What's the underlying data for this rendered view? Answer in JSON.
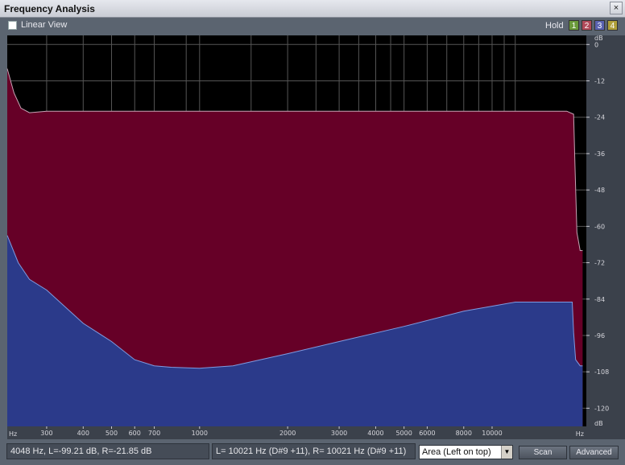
{
  "window": {
    "title": "Frequency Analysis",
    "close_glyph": "×"
  },
  "toolbar": {
    "linear_view_label": "Linear View",
    "linear_view_checked": false,
    "hold_label": "Hold",
    "hold_buttons": [
      {
        "label": "1",
        "color": "#6a9a3a"
      },
      {
        "label": "2",
        "color": "#b04a5a"
      },
      {
        "label": "3",
        "color": "#5a62b0"
      },
      {
        "label": "4",
        "color": "#b0a03a"
      }
    ]
  },
  "chart_data": {
    "type": "area",
    "xscale": "log",
    "xlim": [
      220,
      21000
    ],
    "ylim": [
      -126,
      3
    ],
    "x_unit_left": "Hz",
    "x_unit_right": "Hz",
    "y_unit_top": "dB",
    "y_unit_bottom": "dB",
    "xticks": [
      {
        "value": 300,
        "label": "300"
      },
      {
        "value": 400,
        "label": "400"
      },
      {
        "value": 500,
        "label": "500"
      },
      {
        "value": 600,
        "label": "600"
      },
      {
        "value": 700,
        "label": "700"
      },
      {
        "value": 1000,
        "label": "1000"
      },
      {
        "value": 2000,
        "label": "2000"
      },
      {
        "value": 3000,
        "label": "3000"
      },
      {
        "value": 4000,
        "label": "4000"
      },
      {
        "value": 5000,
        "label": "5000"
      },
      {
        "value": 6000,
        "label": "6000"
      },
      {
        "value": 8000,
        "label": "8000"
      },
      {
        "value": 10000,
        "label": "10000"
      }
    ],
    "x_minor_gridlines": [
      900,
      1500,
      2500,
      3500,
      4500,
      7000,
      9000,
      11000,
      12000
    ],
    "yticks": [
      {
        "value": 0,
        "label": "0"
      },
      {
        "value": -12,
        "label": "-12"
      },
      {
        "value": -24,
        "label": "-24"
      },
      {
        "value": -36,
        "label": "-36"
      },
      {
        "value": -48,
        "label": "-48"
      },
      {
        "value": -60,
        "label": "-60"
      },
      {
        "value": -72,
        "label": "-72"
      },
      {
        "value": -84,
        "label": "-84"
      },
      {
        "value": -96,
        "label": "-96"
      },
      {
        "value": -108,
        "label": "-108"
      },
      {
        "value": -120,
        "label": "-120"
      }
    ],
    "background_color": "#000000",
    "grid_color": "#555555",
    "series": [
      {
        "color": "#660027",
        "line_color": "#c7a4b6",
        "x": [
          220,
          232,
          245,
          262,
          300,
          400,
          600,
          1000,
          2000,
          5000,
          10000,
          18000,
          19000,
          19200,
          19500,
          20000,
          20400
        ],
        "y": [
          -8,
          -16,
          -21,
          -22.5,
          -22,
          -22,
          -22,
          -22,
          -22,
          -22,
          -22,
          -22,
          -23,
          -40,
          -62,
          -68,
          -68
        ]
      },
      {
        "color": "#2b3a8a",
        "line_color": "#7f9be0",
        "x": [
          220,
          240,
          262,
          300,
          400,
          500,
          600,
          700,
          800,
          1000,
          1300,
          2000,
          3000,
          5000,
          8000,
          12000,
          18000,
          18800,
          19000,
          19300,
          20000,
          20400
        ],
        "y": [
          -63,
          -72,
          -77.5,
          -81,
          -92,
          -98,
          -104,
          -106,
          -106.5,
          -106.8,
          -106,
          -102,
          -98,
          -93,
          -88,
          -85,
          -85,
          -85,
          -95,
          -104,
          -106,
          -106
        ]
      }
    ]
  },
  "status": {
    "readout_left": "4048 Hz, L=-99.21 dB, R=-21.85 dB",
    "readout_right": "L=  10021 Hz (D#9 +11), R=  10021 Hz (D#9 +11)",
    "display_mode": "Area (Left on top)",
    "scan_label": "Scan",
    "advanced_label": "Advanced"
  }
}
